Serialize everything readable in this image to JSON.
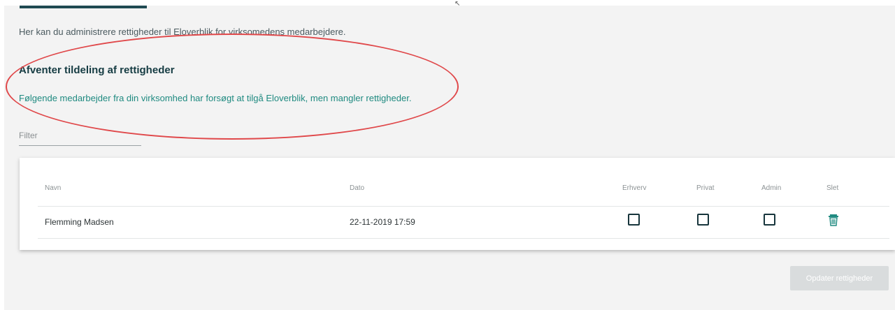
{
  "intro_text": "Her kan du administrere rettigheder til Eloverblik for virksomedens medarbejdere.",
  "pending": {
    "title": "Afventer tildeling af rettigheder",
    "description": "Følgende medarbejder fra din virksomhed har forsøgt at tilgå Eloverblik, men mangler rettigheder."
  },
  "filter": {
    "placeholder": "Filter",
    "value": ""
  },
  "table": {
    "columns": {
      "name": "Navn",
      "date": "Dato",
      "business": "Erhverv",
      "private": "Privat",
      "admin": "Admin",
      "delete": "Slet"
    },
    "rows": [
      {
        "name": "Flemming Madsen",
        "date": "22-11-2019 17:59",
        "business": false,
        "private": false,
        "admin": false
      }
    ]
  },
  "update_button_label": "Opdater rettigheder",
  "colors": {
    "accent_dark": "#1f4a52",
    "link_teal": "#1f8a80",
    "annotation_red": "#e0484a",
    "disabled_button": "#d9dcdd"
  },
  "icons": {
    "delete": "trash-icon"
  }
}
